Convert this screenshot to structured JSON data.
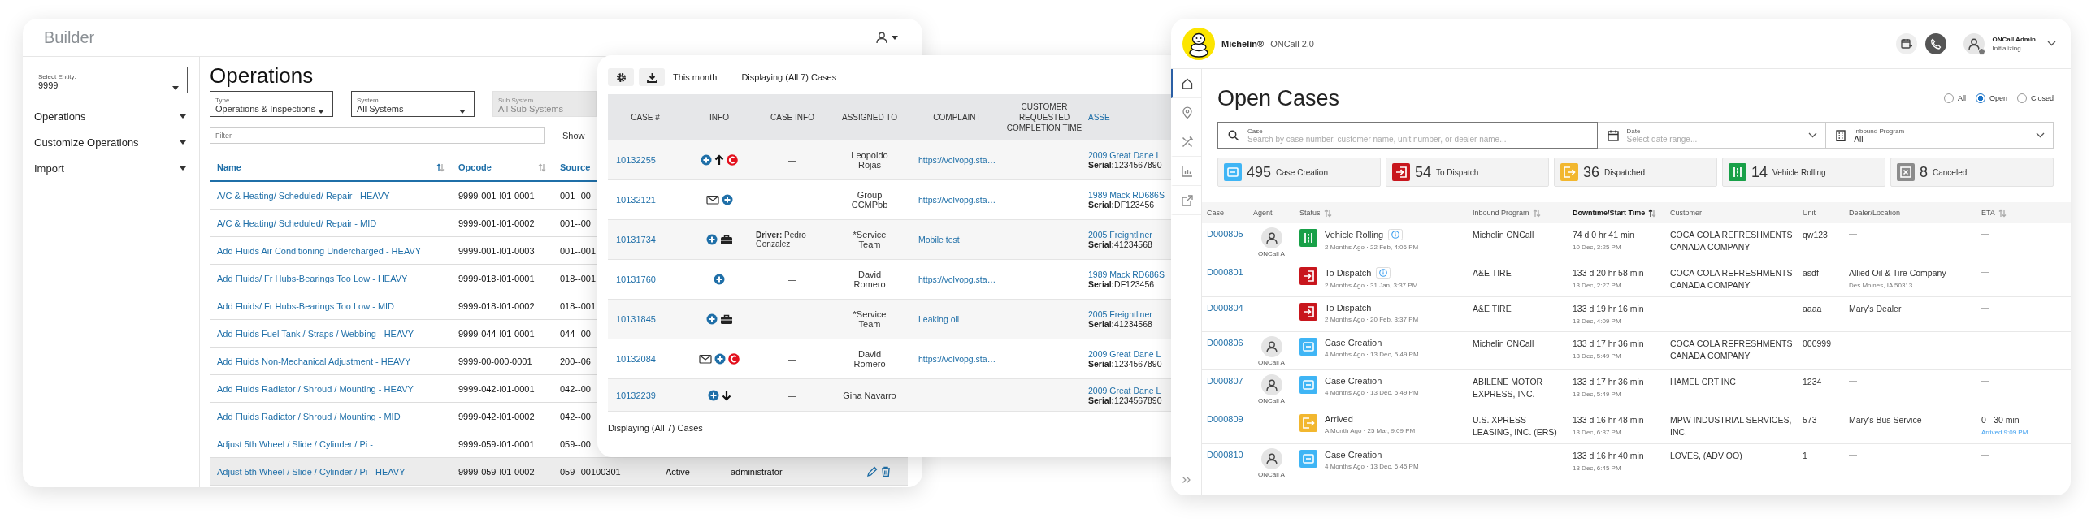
{
  "builder": {
    "title": "Builder",
    "entity": {
      "label": "Select Entity:",
      "value": "9999"
    },
    "sidebar": {
      "items": [
        {
          "label": "Operations"
        },
        {
          "label": "Customize Operations"
        },
        {
          "label": "Import"
        }
      ]
    },
    "heading": "Operations",
    "filters": [
      {
        "label": "Type",
        "value": "Operations & Inspections",
        "disabled": false
      },
      {
        "label": "System",
        "value": "All Systems",
        "disabled": false
      },
      {
        "label": "Sub System",
        "value": "All Sub Systems",
        "disabled": true
      }
    ],
    "filter": {
      "placeholder": "Filter"
    },
    "show_label": "Show",
    "table": {
      "columns": [
        {
          "label": "Name",
          "sorted": true
        },
        {
          "label": "Opcode",
          "sorted": false
        },
        {
          "label": "Source"
        }
      ],
      "rows": [
        {
          "name": "A/C & Heating/ Scheduled/ Repair - HEAVY",
          "opcode": "9999-001-I01-0001",
          "source": "001--00",
          "highlighted": false
        },
        {
          "name": "A/C & Heating/ Scheduled/ Repair - MID",
          "opcode": "9999-001-I01-0002",
          "source": "001--00",
          "highlighted": false
        },
        {
          "name": "Add Fluids Air Conditioning Undercharged - HEAVY",
          "opcode": "9999-001-I01-0003",
          "source": "001--001",
          "highlighted": false
        },
        {
          "name": "Add Fluids/ Fr Hubs-Bearings Too Low - HEAVY",
          "opcode": "9999-018-I01-0001",
          "source": "018--001",
          "highlighted": false
        },
        {
          "name": "Add Fluids/ Fr Hubs-Bearings Too Low - MID",
          "opcode": "9999-018-I01-0002",
          "source": "018--001",
          "highlighted": false
        },
        {
          "name": "Add Fluids Fuel Tank / Straps / Webbing - HEAVY",
          "opcode": "9999-044-I01-0001",
          "source": "044--00",
          "highlighted": false
        },
        {
          "name": "Add Fluids Non-Mechanical Adjustment - HEAVY",
          "opcode": "9999-00-000-0001",
          "source": "200--06",
          "highlighted": false
        },
        {
          "name": "Add Fluids Radiator / Shroud / Mounting - HEAVY",
          "opcode": "9999-042-I01-0001",
          "source": "042--00",
          "highlighted": false
        },
        {
          "name": "Add Fluids Radiator / Shroud / Mounting - MID",
          "opcode": "9999-042-I01-0002",
          "source": "042--00",
          "highlighted": false
        },
        {
          "name": "Adjust 5th Wheel / Slide / Cylinder / Pi -",
          "opcode": "9999-059-I01-0001",
          "source": "059--00",
          "highlighted": false
        },
        {
          "name": "Adjust 5th Wheel / Slide / Cylinder / Pi - HEAVY",
          "opcode": "9999-059-I01-0002",
          "source": "059--00100301",
          "status": "Active",
          "user": "administrator",
          "actions": [
            {
              "kind": "edit"
            },
            {
              "kind": "delete"
            }
          ],
          "highlighted": true
        }
      ]
    }
  },
  "cases": {
    "toolbar": {
      "buttons": [
        {
          "kind": "settings"
        },
        {
          "kind": "download"
        }
      ],
      "period": "This month",
      "count": "Displaying (All 7) Cases"
    },
    "table": {
      "columns": [
        "CASE #",
        "INFO",
        "CASE INFO",
        "ASSIGNED TO",
        "COMPLAINT",
        "CUSTOMER REQUESTED COMPLETION TIME",
        "ASSE"
      ],
      "rows": [
        {
          "case": "10132255",
          "info": [
            {
              "kind": "plus"
            },
            {
              "kind": "up"
            },
            {
              "kind": "c"
            }
          ],
          "case_info": "—",
          "assigned_to": "Leopoldo Rojas",
          "complaint": "https://volvopg.sta…",
          "asset": "2009 Great Dane L",
          "serial": "**Serial:**1234567890"
        },
        {
          "case": "10132121",
          "info": [
            {
              "kind": "mail"
            },
            {
              "kind": "plus"
            }
          ],
          "case_info": "—",
          "assigned_to": "Group CCMPbb",
          "complaint": "https://volvopg.sta…",
          "asset": "1989 Mack RD686S",
          "serial": "**Serial:**DF123456"
        },
        {
          "case": "10131734",
          "info": [
            {
              "kind": "plus"
            },
            {
              "kind": "case"
            }
          ],
          "case_info": "**Driver:** Pedro Gonzalez",
          "assigned_to": "*Service Team",
          "complaint": "Mobile test",
          "asset": "2005 Freightliner",
          "serial": "**Serial:**41234568"
        },
        {
          "case": "10131760",
          "info": [
            {
              "kind": "plus"
            }
          ],
          "case_info": "—",
          "assigned_to": "David Romero",
          "complaint": "https://volvopg.sta…",
          "asset": "1989 Mack RD686S",
          "serial": "**Serial:**DF123456"
        },
        {
          "case": "10131845",
          "info": [
            {
              "kind": "plus"
            },
            {
              "kind": "case"
            }
          ],
          "assigned_to": "*Service Team",
          "complaint": "Leaking oil",
          "asset": "2005 Freightliner",
          "serial": "**Serial:**41234568"
        },
        {
          "case": "10132084",
          "info": [
            {
              "kind": "mail"
            },
            {
              "kind": "plus"
            },
            {
              "kind": "c"
            }
          ],
          "case_info": "—",
          "assigned_to": "David Romero",
          "complaint": "https://volvopg.sta…",
          "asset": "2009 Great Dane L",
          "serial": "**Serial:**1234567890"
        },
        {
          "case": "10132239",
          "info": [
            {
              "kind": "plus"
            },
            {
              "kind": "down"
            }
          ],
          "case_info": "—",
          "assigned_to": "Gina Navarro",
          "asset": "2009 Great Dane L",
          "serial": "**Serial:**1234567890"
        }
      ]
    },
    "footer": "Displaying (All 7) Cases"
  },
  "oncall": {
    "brand": "Michelin®",
    "product": "ONCall 2.0",
    "user": {
      "name": "ONCall Admin",
      "status": "Initializing"
    },
    "nav": {
      "items": [
        {
          "kind": "home",
          "selected": true
        },
        {
          "kind": "pin",
          "selected": false
        },
        {
          "kind": "tools",
          "selected": false
        },
        {
          "kind": "chart",
          "selected": false
        },
        {
          "kind": "external",
          "selected": false
        }
      ]
    },
    "title": "Open Cases",
    "radios": [
      {
        "label": "All",
        "selected": false
      },
      {
        "label": "Open",
        "selected": true
      },
      {
        "label": "Closed",
        "selected": false
      }
    ],
    "search": {
      "label": "Case",
      "placeholder": "Search by case number, customer name, unit number, or dealer name..."
    },
    "date": {
      "label": "Date",
      "placeholder": "Select date range..."
    },
    "program": {
      "label": "Inbound Program",
      "value": "All"
    },
    "stats": [
      {
        "kind": "creation",
        "count": "495",
        "label": "Case Creation",
        "color": "#3fb5f5"
      },
      {
        "kind": "dispatch",
        "count": "54",
        "label": "To Dispatch",
        "color": "#c8161d"
      },
      {
        "kind": "arrived",
        "count": "36",
        "label": "Dispatched",
        "color": "#f2b72f"
      },
      {
        "kind": "rolling",
        "count": "14",
        "label": "Vehicle Rolling",
        "color": "#18a048"
      },
      {
        "kind": "canceled",
        "count": "8",
        "label": "Canceled",
        "color": "#8c8c8c"
      }
    ],
    "table": {
      "columns": [
        {
          "label": "Case"
        },
        {
          "label": "Agent"
        },
        {
          "label": "Status",
          "sortable": true
        },
        {
          "label": "Inbound Program",
          "sortable": true
        },
        {
          "label": "Downtime/Start Time",
          "sortable": true,
          "active": true
        },
        {
          "label": "Customer"
        },
        {
          "label": "Unit"
        },
        {
          "label": "Dealer/Location"
        },
        {
          "label": "ETA",
          "sortable": true
        }
      ],
      "rows": [
        {
          "case": "D000805",
          "agent": "ONCall A",
          "kind": "rolling",
          "status": "Vehicle Rolling",
          "info": true,
          "status_time": "2 Months Ago · 22 Feb, 4:06 PM",
          "program": "Michelin ONCall",
          "downtime": "74 d 0 hr 41 min",
          "start": "10 Dec, 3:25 PM",
          "customer": "COCA COLA REFRESHMENTS CANADA COMPANY",
          "unit": "qw123",
          "dealer": "—",
          "eta": "—"
        },
        {
          "case": "D000801",
          "kind": "dispatch",
          "status": "To Dispatch",
          "info": true,
          "status_time": "2 Months Ago · 31 Jan, 3:37 PM",
          "program": "A&E TIRE",
          "downtime": "133 d 20 hr 58 min",
          "start": "13 Dec, 2:27 PM",
          "customer": "COCA COLA REFRESHMENTS CANADA COMPANY",
          "unit": "asdf",
          "dealer": "Allied Oil & Tire Company",
          "dealer_location": "Des Moines, IA 50313",
          "eta": "—"
        },
        {
          "case": "D000804",
          "kind": "dispatch",
          "status": "To Dispatch",
          "info": false,
          "status_time": "2 Months Ago · 20 Feb, 3:37 PM",
          "program": "A&E TIRE",
          "downtime": "133 d 19 hr 16 min",
          "start": "13 Dec, 4:09 PM",
          "customer": "—",
          "unit": "aaaa",
          "dealer": "Mary's Dealer",
          "eta": "—"
        },
        {
          "case": "D000806",
          "agent": "ONCall A",
          "kind": "creation",
          "status": "Case Creation",
          "info": false,
          "status_time": "4 Months Ago · 13 Dec, 5:49 PM",
          "program": "Michelin ONCall",
          "downtime": "133 d 17 hr 36 min",
          "start": "13 Dec, 5:49 PM",
          "customer": "COCA COLA REFRESHMENTS CANADA COMPANY",
          "unit": "000999",
          "dealer": "—",
          "eta": "—"
        },
        {
          "case": "D000807",
          "agent": "ONCall A",
          "kind": "creation",
          "status": "Case Creation",
          "info": false,
          "status_time": "4 Months Ago · 13 Dec, 5:49 PM",
          "program": "ABILENE MOTOR EXPRESS, INC.",
          "downtime": "133 d 17 hr 36 min",
          "start": "13 Dec, 5:49 PM",
          "customer": "HAMEL CRT INC",
          "unit": "1234",
          "dealer": "—",
          "eta": "—"
        },
        {
          "case": "D000809",
          "kind": "arrived",
          "status": "Arrived",
          "info": false,
          "status_time": "A Month Ago · 25 Mar, 9:09 PM",
          "program": "U.S. XPRESS LEASING, INC. (ERS)",
          "downtime": "133 d 16 hr 48 min",
          "start": "13 Dec, 6:37 PM",
          "customer": "MPW INDUSTRIAL SERVICES, INC.",
          "unit": "573",
          "dealer": "Mary's Bus Service",
          "eta": "0 - 30 min",
          "eta_note": "Arrived 9:09 PM"
        },
        {
          "case": "D000810",
          "agent": "ONCall A",
          "kind": "creation",
          "status": "Case Creation",
          "info": false,
          "status_time": "4 Months Ago · 13 Dec, 6:45 PM",
          "program": "—",
          "downtime": "133 d 16 hr 40 min",
          "start": "13 Dec, 6:45 PM",
          "customer": "LOVES, (ADV OO)",
          "unit": "1",
          "dealer": "—",
          "eta": "—"
        }
      ]
    }
  }
}
